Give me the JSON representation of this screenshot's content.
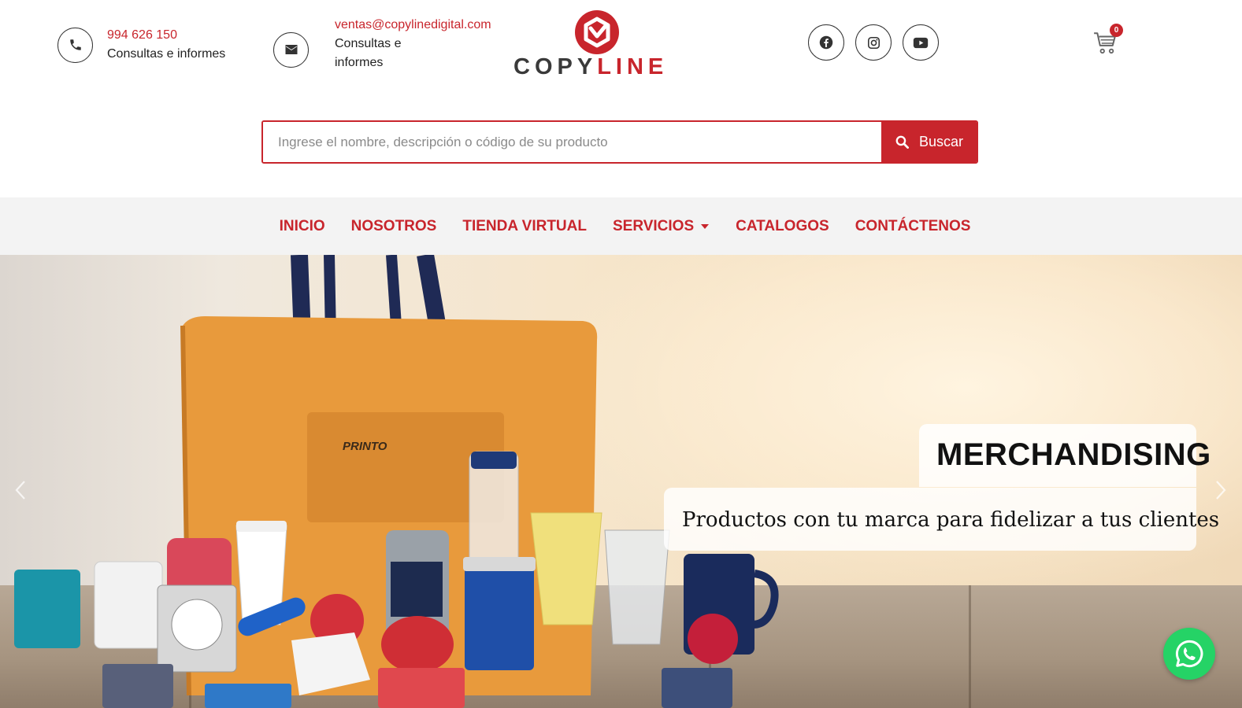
{
  "header": {
    "phone": {
      "number": "994 626 150",
      "caption": "Consultas e informes",
      "icon": "phone-icon"
    },
    "mail": {
      "address": "ventas@copylinedigital.com",
      "caption": "Consultas e informes",
      "icon": "envelope-icon"
    },
    "logo": {
      "word_dark": "COPY",
      "word_red": "LINE"
    },
    "socials": [
      {
        "name": "facebook",
        "icon": "facebook-icon"
      },
      {
        "name": "instagram",
        "icon": "instagram-icon"
      },
      {
        "name": "youtube",
        "icon": "youtube-icon"
      }
    ],
    "cart": {
      "count": "0",
      "icon": "cart-icon"
    }
  },
  "search": {
    "placeholder": "Ingrese el nombre, descripción o código de su producto",
    "value": "",
    "button_label": "Buscar",
    "icon": "search-icon"
  },
  "nav": {
    "items": [
      {
        "label": "INICIO"
      },
      {
        "label": "NOSOTROS"
      },
      {
        "label": "TIENDA VIRTUAL"
      },
      {
        "label": "SERVICIOS",
        "has_dropdown": true
      },
      {
        "label": "CATALOGOS"
      },
      {
        "label": "CONTÁCTENOS"
      }
    ]
  },
  "hero": {
    "title": "MERCHANDISING",
    "subtitle": "Productos con tu marca para fidelizar a tus clientes",
    "bag_brand": "PRINTO"
  },
  "colors": {
    "brand_red": "#c8252c",
    "nav_bg": "#f3f3f3",
    "whatsapp_green": "#25d366"
  },
  "floating": {
    "whatsapp_icon": "whatsapp-icon"
  }
}
